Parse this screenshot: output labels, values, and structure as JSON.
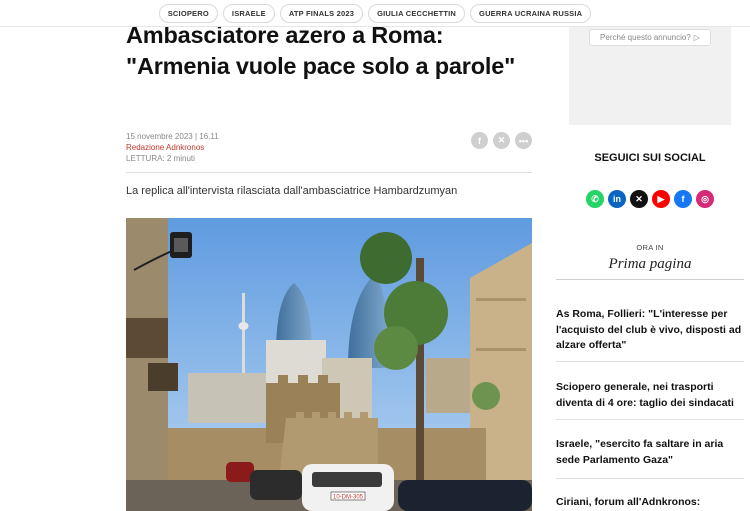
{
  "tags": [
    "SCIOPERO",
    "ISRAELE",
    "ATP FINALS 2023",
    "GIULIA CECCHETTIN",
    "GUERRA UCRAINA RUSSIA"
  ],
  "article": {
    "title": "Ambasciatore azero a Roma: \"Armenia vuole pace solo a parole\"",
    "date": "15 novembre 2023 | 16.11",
    "author": "Redazione Adnkronos",
    "reading": "LETTURA: 2 minuti",
    "lead": "La replica all'intervista rilasciata dall'ambasciatrice Hambardzumyan",
    "photo": {
      "plate": "10-DM-305"
    },
    "share_icons": [
      "facebook-icon",
      "x-icon",
      "more-icon"
    ]
  },
  "sidebar": {
    "ad_label": "Perché questo annuncio?",
    "social_title": "SEGUICI SUI SOCIAL",
    "social": [
      {
        "name": "whatsapp-icon",
        "glyph": "✆",
        "color": "#25d366"
      },
      {
        "name": "linkedin-icon",
        "glyph": "in",
        "color": "#0a66c2"
      },
      {
        "name": "x-icon",
        "glyph": "✕",
        "color": "#111111"
      },
      {
        "name": "youtube-icon",
        "glyph": "▶",
        "color": "#ff0000"
      },
      {
        "name": "facebook-icon",
        "glyph": "f",
        "color": "#1877f2"
      },
      {
        "name": "instagram-icon",
        "glyph": "◎",
        "color": "#d62976"
      }
    ],
    "ora_in": "ORA IN",
    "prima_pagina": "Prima pagina",
    "news": [
      "As Roma, Follieri: \"L'interesse per l'acquisto del club è vivo, disposti ad alzare offerta\"",
      "Sciopero generale, nei trasporti diventa di 4 ore: taglio dei sindacati",
      "Israele, \"esercito fa saltare in aria sede Parlamento Gaza\"",
      "Ciriani, forum all'Adnkronos:"
    ]
  }
}
